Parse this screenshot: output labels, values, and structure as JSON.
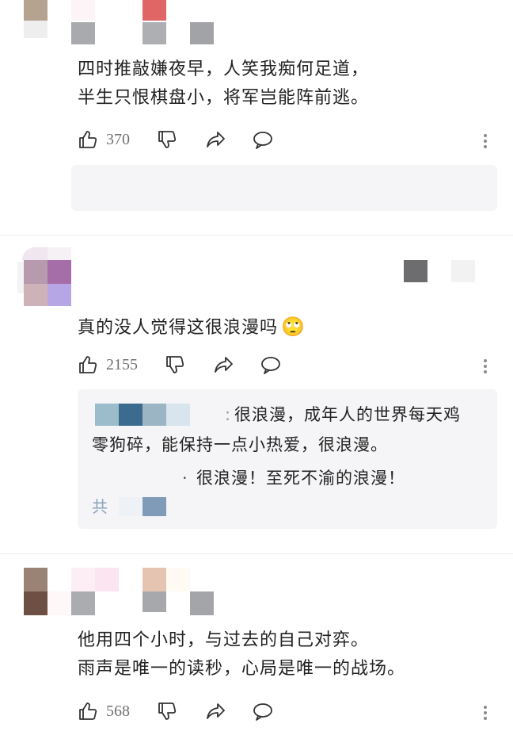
{
  "comments": [
    {
      "lines": [
        "四时推敲嫌夜早，人笑我痴何足道，",
        "半生只恨棋盘小，将军岂能阵前逃。"
      ],
      "like_count": "370"
    },
    {
      "lines": [
        "真的没人觉得这很浪漫吗"
      ],
      "emoji": "🙄",
      "like_count": "2155",
      "replies": [
        {
          "prefix": ":",
          "text_line1": "很浪漫，成年人的世界每天鸡",
          "text_line2": "零狗碎，能保持一点小热爱，很浪漫。"
        },
        {
          "prefix": "·",
          "text": "很浪漫！至死不渝的浪漫！"
        }
      ],
      "more_replies_fragment": "共"
    },
    {
      "lines": [
        "他用四个小时，与过去的自己对弈。",
        "雨声是唯一的读秒，心局是唯一的战场。"
      ],
      "like_count": "568"
    }
  ],
  "icons": [
    "thumbs-up-icon",
    "thumbs-down-icon",
    "share-icon",
    "comment-icon",
    "more-icon"
  ],
  "colors": {
    "background": "#ffffff",
    "reply_bg": "#f5f5f7",
    "text": "#222222",
    "muted": "#707070"
  }
}
